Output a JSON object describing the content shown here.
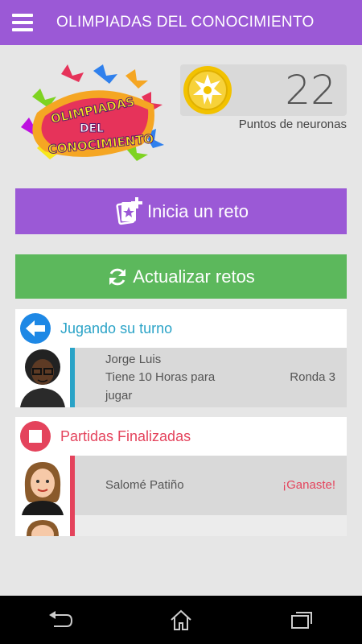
{
  "header": {
    "title": "OLIMPIADAS DEL CONOCIMIENTO"
  },
  "logo": {
    "line1": "OLIMPIADAS",
    "line2": "DEL",
    "line3": "CONOCIMIENTO"
  },
  "score": {
    "value": "22",
    "label": "Puntos de neuronas"
  },
  "buttons": {
    "start_challenge": "Inicia un reto",
    "refresh": "Actualizar retos"
  },
  "playing": {
    "title": "Jugando su turno",
    "items": [
      {
        "name": "Jorge Luis",
        "status": "Tiene 10 Horas para jugar",
        "round": "Ronda 3"
      }
    ]
  },
  "finished": {
    "title": "Partidas Finalizadas",
    "items": [
      {
        "name": "Salomé Patiño",
        "result": "¡Ganaste!"
      }
    ]
  },
  "colors": {
    "primary": "#9b59d6",
    "green": "#5cb85c",
    "blue": "#2aa3c7",
    "red": "#e4435c"
  }
}
